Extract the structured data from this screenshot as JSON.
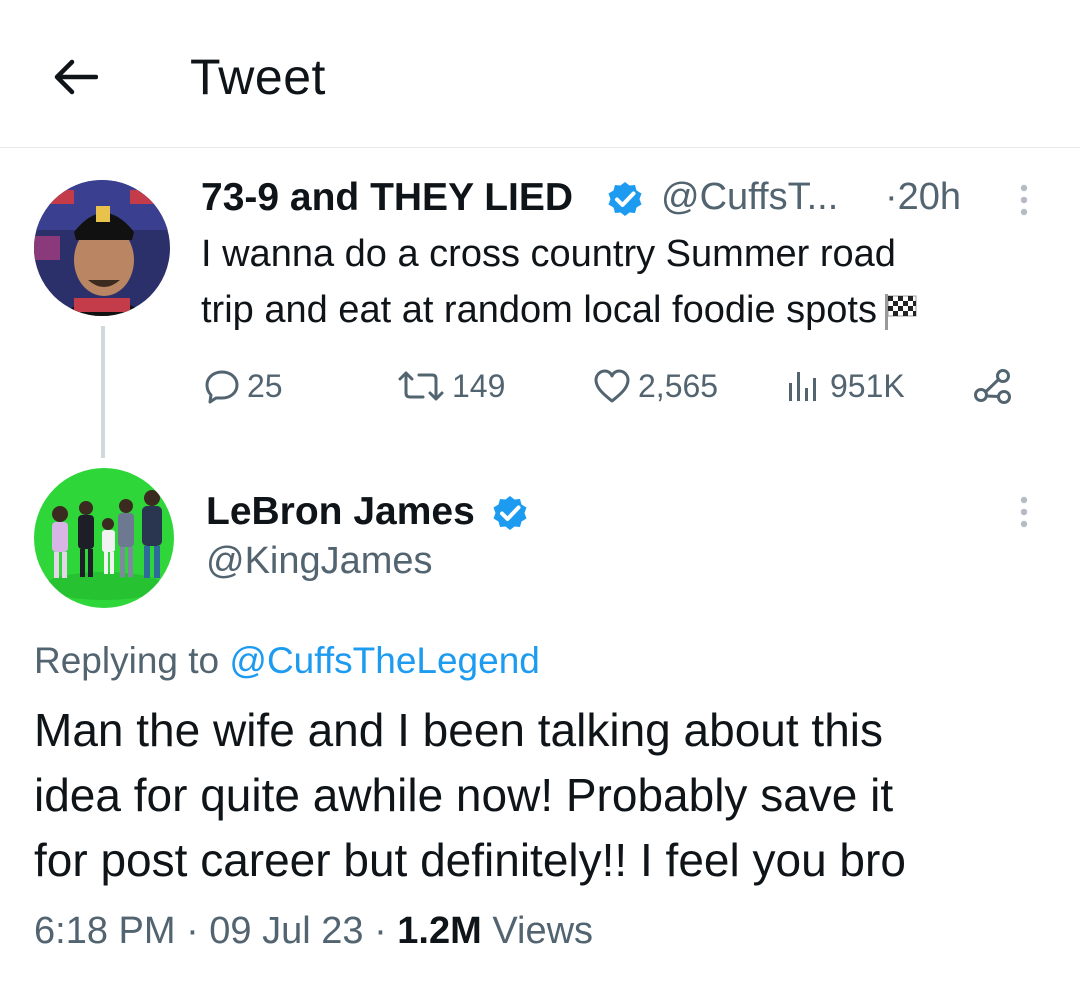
{
  "header": {
    "title": "Tweet",
    "back_icon": "arrow-left-icon"
  },
  "parent_tweet": {
    "author_name": "73-9 and THEY LIED",
    "handle": "@CuffsT...",
    "time": "·20h",
    "text_line1": "I wanna do a cross country Summer road",
    "text_line2": "trip and eat at random local foodie spots",
    "emoji_icon": "checkered-flag-icon",
    "stats": {
      "replies": "25",
      "retweets": "149",
      "likes": "2,565",
      "views": "951K"
    }
  },
  "main_tweet": {
    "author_name": "LeBron James",
    "handle": "@KingJames",
    "replying_prefix": "Replying to",
    "replying_to": "@CuffsTheLegend",
    "text_line1": "Man the wife and I been talking about this",
    "text_line2": "idea for quite awhile now! Probably save it",
    "text_line3": "for post career but definitely!! I feel you bro",
    "timestamp": "6:18 PM · 09 Jul 23 · ",
    "views_count": "1.2M",
    "views_label": " Views"
  },
  "colors": {
    "accent": "#1d9bf0",
    "secondary_text": "#536471",
    "primary_text": "#0f1419",
    "divider": "#cfd9de"
  }
}
